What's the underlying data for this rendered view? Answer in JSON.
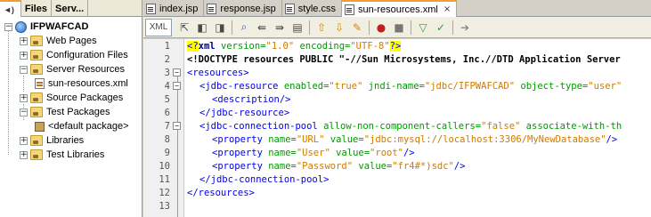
{
  "left_panel": {
    "tabs": [
      {
        "label": "◄|►",
        "prefix": "",
        "text": "Files"
      },
      {
        "label": "Files"
      },
      {
        "label": "Serv..."
      }
    ],
    "tab_active_label": "◄)",
    "tab_files": "Files",
    "tab_services": "Serv...",
    "tree": {
      "project": "IFPWAFCAD",
      "web_pages": "Web Pages",
      "config_files": "Configuration Files",
      "server_resources": "Server Resources",
      "sun_resources": "sun-resources.xml",
      "source_packages": "Source Packages",
      "test_packages": "Test Packages",
      "default_package": "<default package>",
      "libraries": "Libraries",
      "test_libraries": "Test Libraries"
    }
  },
  "editor": {
    "tabs": [
      "index.jsp",
      "response.jsp",
      "style.css",
      "sun-resources.xml"
    ],
    "close_glyph": "×",
    "toolbar": {
      "xml_label": "XML"
    },
    "lines": [
      {
        "n": "1"
      },
      {
        "n": "2"
      },
      {
        "n": "3"
      },
      {
        "n": "4"
      },
      {
        "n": "5"
      },
      {
        "n": "6"
      },
      {
        "n": "7"
      },
      {
        "n": "8"
      },
      {
        "n": "9"
      },
      {
        "n": "10"
      },
      {
        "n": "11"
      },
      {
        "n": "12"
      },
      {
        "n": "13"
      }
    ],
    "code": {
      "l1_a": "<?",
      "l1_b": "xml",
      "l1_c": " version=",
      "l1_d": "\"1.0\"",
      "l1_e": " encoding=",
      "l1_f": "\"UTF-8\"",
      "l1_g": "?>",
      "l2": "<!DOCTYPE resources PUBLIC \"-//Sun Microsystems, Inc.//DTD Application Server",
      "l3": "<resources>",
      "l4_tag": "<jdbc-resource",
      "l4_a1": " enabled=",
      "l4_v1": "\"true\"",
      "l4_a2": " jndi-name=",
      "l4_v2": "\"jdbc/IFPWAFCAD\"",
      "l4_a3": " object-type=",
      "l4_v3": "\"user\"",
      "l5": "<description/>",
      "l6": "</jdbc-resource>",
      "l7_tag": "<jdbc-connection-pool",
      "l7_a1": " allow-non-component-callers=",
      "l7_v1": "\"false\"",
      "l7_a2": " associate-with-th",
      "l8_tag": "<property",
      "l8_a1": " name=",
      "l8_v1": "\"URL\"",
      "l8_a2": " value=",
      "l8_v2": "\"jdbc:mysql://localhost:3306/MyNewDatabase\"",
      "l8_end": "/>",
      "l9_tag": "<property",
      "l9_a1": " name=",
      "l9_v1": "\"User\"",
      "l9_a2": " value=",
      "l9_v2": "\"root\"",
      "l9_end": "/>",
      "l10_tag": "<property",
      "l10_a1": " name=",
      "l10_v1": "\"Password\"",
      "l10_a2": " value=",
      "l10_v2": "\"fr4#*)sdc\"",
      "l10_end": "/>",
      "l11": "</jdbc-connection-pool>",
      "l12": "</resources>"
    }
  }
}
